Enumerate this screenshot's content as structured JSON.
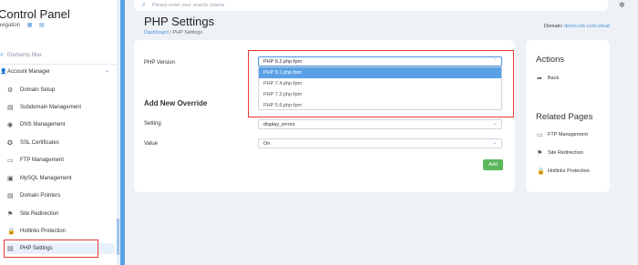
{
  "sidebar": {
    "title": "Control Panel",
    "navigation_label": "avigation",
    "filter_placeholder": "Elements filter",
    "group_label": "Account Manager",
    "items": [
      {
        "label": "Domain Setup",
        "icon": "domain-setup-icon"
      },
      {
        "label": "Subdomain Management",
        "icon": "subdomain-icon"
      },
      {
        "label": "DNS Management",
        "icon": "dns-icon"
      },
      {
        "label": "SSL Certificates",
        "icon": "ssl-icon"
      },
      {
        "label": "FTP Management",
        "icon": "ftp-icon"
      },
      {
        "label": "MySQL Management",
        "icon": "mysql-icon"
      },
      {
        "label": "Domain Pointers",
        "icon": "domain-pointers-icon"
      },
      {
        "label": "Site Redirection",
        "icon": "site-redirection-icon"
      },
      {
        "label": "Hotlinks Protection",
        "icon": "hotlinks-icon"
      },
      {
        "label": "PHP Settings",
        "icon": "php-settings-icon"
      }
    ],
    "active_item": "PHP Settings"
  },
  "search": {
    "placeholder": "Please enter your search criteria"
  },
  "header": {
    "title": "PHP Settings",
    "breadcrumb_link": "Dashboard",
    "breadcrumb_current": " / PHP Settings",
    "domain_label": "Domain:",
    "domain_value": "demo.ruk-com.cloud"
  },
  "form": {
    "php_version_label": "PHP Version",
    "php_version_value": "PHP 8.2.php-fpm",
    "php_version_options": [
      "PHP 8.1.php-fpm",
      "PHP 7.4.php-fpm",
      "PHP 7.2.php-fpm",
      "PHP 5.6.php-fpm"
    ],
    "selected_option_index": 0,
    "override_title": "Add New Override",
    "setting_label": "Setting",
    "setting_value": "display_errors",
    "value_label": "Value",
    "value_value": "On",
    "add_button": "Add"
  },
  "actions": {
    "title": "Actions",
    "back_label": "Back"
  },
  "related": {
    "title": "Related Pages",
    "items": [
      "FTP Management",
      "Site Redirection",
      "Hotlinks Protection"
    ]
  },
  "colors": {
    "accent": "#4a90d9",
    "sidebar_divider": "#5aa0e6",
    "add_button": "#5cb85c",
    "highlight_border": "#e53935"
  }
}
